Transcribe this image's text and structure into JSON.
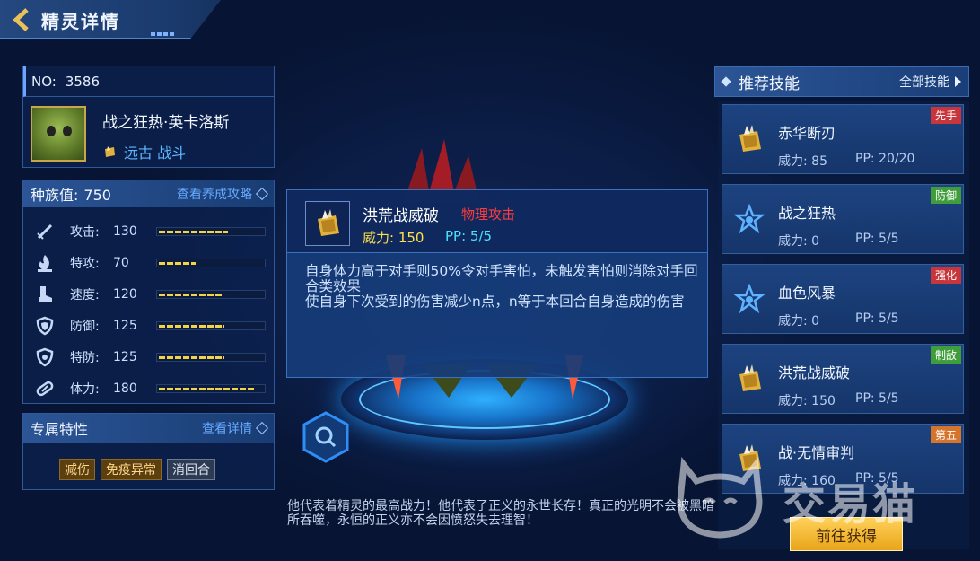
{
  "header": {
    "title": "精灵详情"
  },
  "pet": {
    "no_label": "NO:",
    "no_value": "3586",
    "name": "战之狂热·英卡洛斯",
    "type": "远古 战斗"
  },
  "stats": {
    "title": "种族值:",
    "total": "750",
    "guide_link": "查看养成攻略",
    "items": [
      {
        "name": "攻击:",
        "value": "130",
        "level": 0.65,
        "icon": "sword-icon"
      },
      {
        "name": "特攻:",
        "value": "70",
        "level": 0.35,
        "icon": "flame-icon"
      },
      {
        "name": "速度:",
        "value": "120",
        "level": 0.6,
        "icon": "boot-icon"
      },
      {
        "name": "防御:",
        "value": "125",
        "level": 0.62,
        "icon": "shield-icon"
      },
      {
        "name": "特防:",
        "value": "125",
        "level": 0.62,
        "icon": "magic-shield-icon"
      },
      {
        "name": "体力:",
        "value": "180",
        "level": 0.9,
        "icon": "capsule-icon"
      }
    ]
  },
  "traits": {
    "title": "专属特性",
    "details_link": "查看详情",
    "tags": [
      "减伤",
      "免疫异常",
      "消回合"
    ]
  },
  "popup": {
    "name": "洪荒战威破",
    "kind": "物理攻击",
    "power": "威力: 150",
    "pp": "PP: 5/5",
    "desc_1": "自身体力高于对手则50%令对手害怕，未触发害怕则消除对手回合类效果",
    "desc_2": "使自身下次受到的伤害减少n点，n等于本回合自身造成的伤害"
  },
  "quote": "他代表着精灵的最高战力！他代表了正义的永世长存！真正的光明不会被黑暗所吞噬，永恒的正义亦不会因愤怒失去理智！",
  "skills": {
    "title": "推荐技能",
    "all_link": "全部技能",
    "items": [
      {
        "name": "赤华断刃",
        "power": "威力: 85",
        "pp": "PP: 20/20",
        "badge": "先手",
        "badge_color": "#c8353a",
        "icon": "crystal-icon"
      },
      {
        "name": "战之狂热",
        "power": "威力: 0",
        "pp": "PP: 5/5",
        "badge": "防御",
        "badge_color": "#3f9d3a",
        "icon": "star-icon"
      },
      {
        "name": "血色风暴",
        "power": "威力: 0",
        "pp": "PP: 5/5",
        "badge": "强化",
        "badge_color": "#c8353a",
        "icon": "star-icon"
      },
      {
        "name": "洪荒战威破",
        "power": "威力: 150",
        "pp": "PP: 5/5",
        "badge": "制敌",
        "badge_color": "#3f9d3a",
        "icon": "crystal-icon"
      },
      {
        "name": "战·无情审判",
        "power": "威力: 160",
        "pp": "PP: 5/5",
        "badge": "第五",
        "badge_color": "#d6742b",
        "icon": "crystal-icon"
      }
    ]
  },
  "go_button": "前往获得",
  "watermark": "交易猫"
}
